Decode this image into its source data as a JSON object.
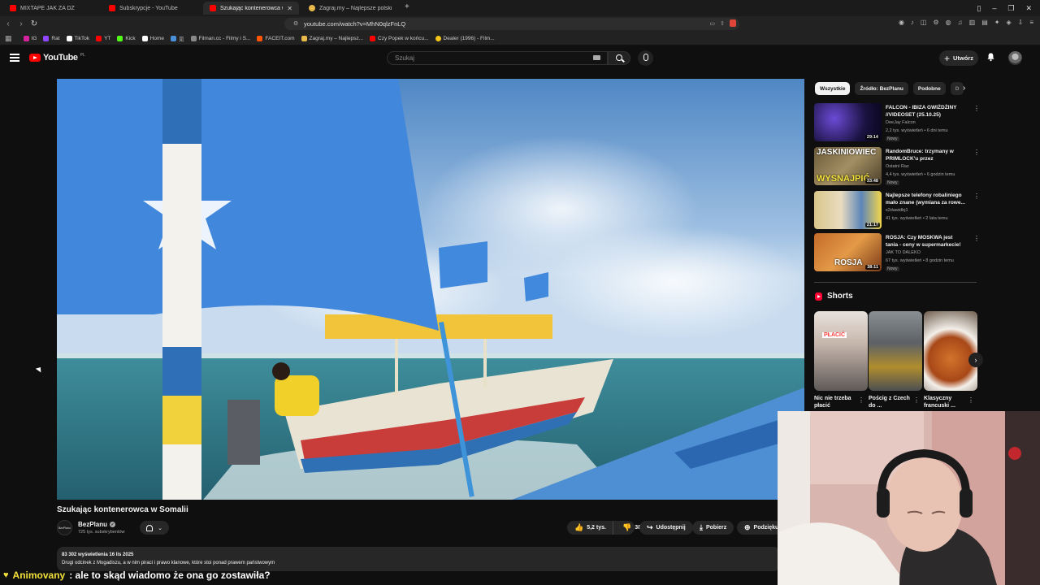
{
  "browser": {
    "tabs": [
      {
        "label": "MIXTAPE JAK ZA DZ",
        "icon_color": "#ff0000"
      },
      {
        "label": "Subskrypcje - YouTube",
        "icon_color": "#ff0000"
      },
      {
        "label": "Szukając kontenerowca w So",
        "icon_color": "#ff0000",
        "active": true
      },
      {
        "label": "Zagraj.my – Najlepsze polskie quizy",
        "icon_color": "#e7b84a"
      }
    ],
    "new_tab": "+",
    "url": "youtube.com/watch?v=MhN0qlzFnLQ",
    "bookmarks": [
      {
        "label": "IG",
        "icon_color": "#d6249f"
      },
      {
        "label": "Rat",
        "icon_color": "#9146ff"
      },
      {
        "label": "TikTok",
        "icon_color": "#ffffff"
      },
      {
        "label": "YT",
        "icon_color": "#ff0000"
      },
      {
        "label": "Kick",
        "icon_color": "#53fc18"
      },
      {
        "label": "Home",
        "icon_color": "#ffffff"
      },
      {
        "label": "见",
        "icon_color": "#4a90d9"
      },
      {
        "label": "Filman.cc - Filmy i S...",
        "icon_color": "#888888"
      },
      {
        "label": "FACEIT.com",
        "icon_color": "#ff5500"
      },
      {
        "label": "Zagraj.my – Najlepsz...",
        "icon_color": "#e7b84a"
      },
      {
        "label": "Czy Popek w końcu...",
        "icon_color": "#ff0000"
      },
      {
        "label": "Dealer (1996) - Film...",
        "icon_color": "#f5c518"
      }
    ]
  },
  "youtube": {
    "logo_text": "YouTube",
    "region": "PL",
    "search_placeholder": "Szukaj",
    "create_label": "Utwórz"
  },
  "video": {
    "title": "Szukając kontenerowca w Somalii",
    "channel_name": "BezPlanu",
    "channel_avatar_text": "BezPlanu",
    "subscribers": "725 tys. subskrybentów",
    "likes": "5,2 tys.",
    "dislikes": "38",
    "share_label": "Udostępnij",
    "download_label": "Pobierz",
    "thanks_label": "Podziękuj",
    "stats": "83 302 wyświetlenia  16 lis 2025",
    "description": "Drugi odcinek z Mogadiszu, a w nim piraci i prawo klanowe, które stoi ponad prawem państwowym"
  },
  "sidebar": {
    "chips": [
      "Wszystkie",
      "Źródło: BezPlanu",
      "Podobne",
      "D"
    ],
    "recommendations": [
      {
        "title": "FALCON - IBIZA GWIŻDŻINY //VIDEOSET (25.10.25)",
        "channel": "DeeJay Falcon",
        "meta": "2,2 tys. wyświetleń • 6 dni temu",
        "badge": "Nowy",
        "duration": "29:14"
      },
      {
        "title": "RandomBruce: trzymany w PRIMLOCK'u przez WŁASNYC...",
        "channel": "Ostatni Raz",
        "meta": "4,4 tys. wyświetleń • 6 godzin temu",
        "badge": "Nowy",
        "duration": "33:48"
      },
      {
        "title": "Najlepsze telefony robaliniego mało znane (wymiana za rowe...",
        "channel": "s2dawidbj1",
        "meta": "41 tys. wyświetleń • 2 lata temu",
        "badge": "",
        "duration": "21:17"
      },
      {
        "title": "ROSJA: Czy MOSKWA jest tania - ceny w supermarkecie! Podr...",
        "channel": "JAK TO DALEKO",
        "meta": "67 tys. wyświetleń • 8 godzin temu",
        "badge": "Nowy",
        "duration": "38:11"
      }
    ],
    "thumb_texts": [
      "JASKINIOWIEC",
      "WYSNAJPIĆ",
      "ROSJA"
    ],
    "shorts_heading": "Shorts",
    "shorts": [
      {
        "title": "Nic nie trzeba płacić",
        "thumb_text": "PŁACIĆ"
      },
      {
        "title": "Pościg z Czech do ...",
        "thumb_text": ""
      },
      {
        "title": "Klasyczny francuski ...",
        "thumb_text": ""
      }
    ]
  },
  "chat": {
    "user": "Animovany",
    "message": ": ale to skąd wiadomo że ona go zostawiła?"
  }
}
